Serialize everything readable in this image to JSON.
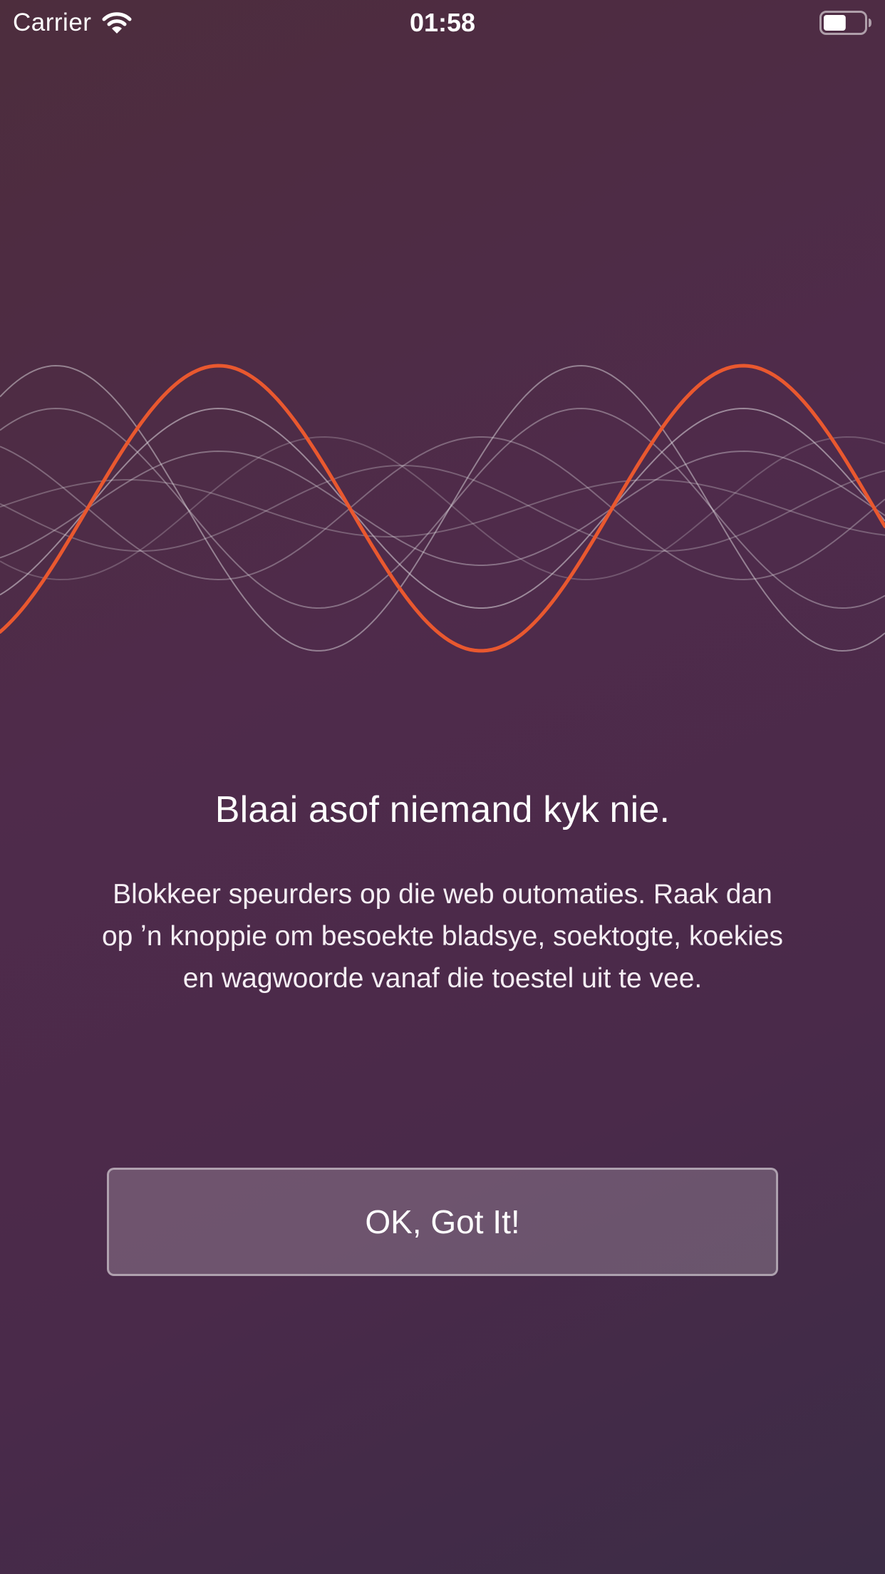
{
  "status_bar": {
    "carrier": "Carrier",
    "time": "01:58",
    "wifi_icon": "wifi-icon",
    "battery_icon": "battery-icon",
    "battery_level": 0.55
  },
  "onboarding": {
    "illustration_icon": "sound-waves-illustration",
    "accent_color": "#e9582f",
    "headline": "Blaai asof niemand kyk nie.",
    "body": "Blokkeer speurders op die web outomaties. Raak dan op ʼn knoppie om besoekte bladsye, soektogte, koekies en wagwoorde vanaf die toestel uit te vee.",
    "button_label": "OK, Got It!"
  }
}
